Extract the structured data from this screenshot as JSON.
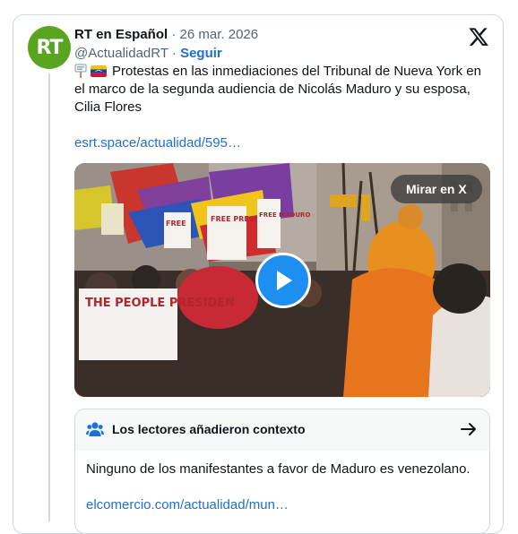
{
  "tweet": {
    "author_name": "RT en Español",
    "avatar_label": "RT",
    "separator": "·",
    "date": "26 mar. 2026",
    "handle": "@ActualidadRT",
    "follow_label": "Seguir",
    "text": "Protestas en las inmediaciones del Tribunal de Nueva York en el marco de la segunda audiencia de Nicolás Maduro y su esposa, Cilia Flores",
    "link": "esrt.space/actualidad/595…",
    "logo_icon": "x-logo-icon",
    "emojis": [
      "placard-icon",
      "venezuela-flag-icon"
    ]
  },
  "media": {
    "watch_label": "Mirar en X",
    "play_icon": "play-icon",
    "signs": {
      "free_president": "FREE PRESIDENT",
      "the_people": "THE PEOPLE PRESIDEN",
      "free_maduro": "FREE MADURO",
      "free": "FREE"
    }
  },
  "community_note": {
    "title": "Los lectores añadieron contexto",
    "body": "Ninguno de los manifestantes a favor de Maduro es venezolano.",
    "link": "elcomercio.com/actualidad/mun…",
    "icon": "users-icon",
    "arrow_icon": "arrow-right-icon"
  },
  "colors": {
    "link": "#1d6fd1",
    "avatar": "#5aa51f",
    "play": "#1d8ff0",
    "border": "#cfd9de"
  }
}
